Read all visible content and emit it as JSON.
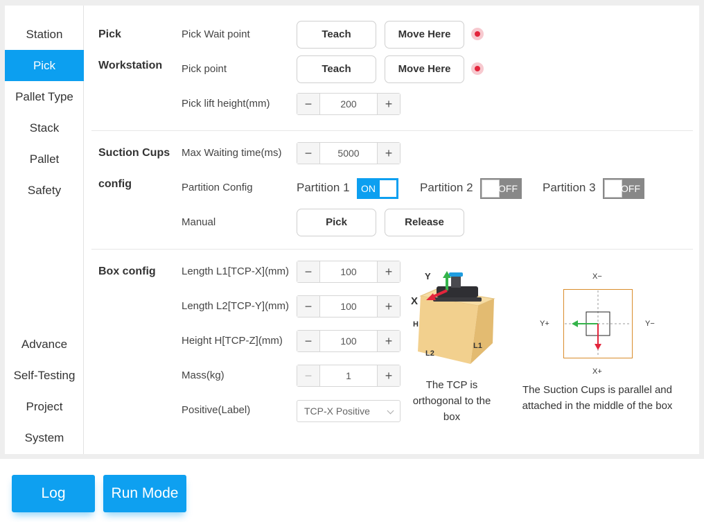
{
  "sidebar": {
    "items": [
      {
        "label": "Station"
      },
      {
        "label": "Pick",
        "active": true
      },
      {
        "label": "Pallet Type"
      },
      {
        "label": "Stack"
      },
      {
        "label": "Pallet"
      },
      {
        "label": "Safety"
      },
      {
        "label": "Advance"
      },
      {
        "label": "Self-Testing"
      },
      {
        "label": "Project"
      },
      {
        "label": "System"
      }
    ]
  },
  "pick_workstation": {
    "title_line1": "Pick",
    "title_line2": "Workstation",
    "wait_point_label": "Pick Wait point",
    "pick_point_label": "Pick point",
    "lift_height_label": "Pick lift height(mm)",
    "lift_height_value": "200",
    "teach_label": "Teach",
    "move_here_label": "Move Here",
    "stepper_minus": "−",
    "stepper_plus": "+"
  },
  "suction_cups": {
    "title_line1": "Suction Cups",
    "title_line2": "config",
    "max_wait_label": "Max Waiting time(ms)",
    "max_wait_value": "5000",
    "partition_config_label": "Partition Config",
    "partitions": [
      {
        "label": "Partition 1",
        "state": "ON"
      },
      {
        "label": "Partition 2",
        "state": "OFF"
      },
      {
        "label": "Partition 3",
        "state": "OFF"
      }
    ],
    "manual_label": "Manual",
    "pick_label": "Pick",
    "release_label": "Release"
  },
  "box_config": {
    "title": "Box config",
    "length_l1_label": "Length L1[TCP-X](mm)",
    "length_l1_value": "100",
    "length_l2_label": "Length L2[TCP-Y](mm)",
    "length_l2_value": "100",
    "height_label": "Height H[TCP-Z](mm)",
    "height_value": "100",
    "mass_label": "Mass(kg)",
    "mass_value": "1",
    "positive_label": "Positive(Label)",
    "positive_value": "TCP-X Positive",
    "tcp_caption_1": "The TCP is",
    "tcp_caption_2": "orthogonal to the",
    "tcp_caption_3": "box",
    "box_axis_y": "Y",
    "box_axis_x": "X",
    "box_edge_h": "H",
    "box_edge_l1": "L1",
    "box_edge_l2": "L2",
    "diagram_x_minus": "X−",
    "diagram_x_plus": "X+",
    "diagram_y_plus": "Y+",
    "diagram_y_minus": "Y−",
    "suction_caption_1": "The Suction Cups is parallel and",
    "suction_caption_2": "attached in the middle of the box"
  },
  "bottom_bar": {
    "log_label": "Log",
    "run_mode_label": "Run Mode"
  },
  "colors": {
    "accent": "#0c9ff0",
    "toggle_off": "#888888",
    "dot_red": "#e3253c",
    "diagram_box": "#d98c2a",
    "arrow_green": "#34b34a",
    "arrow_red": "#e3253c"
  }
}
